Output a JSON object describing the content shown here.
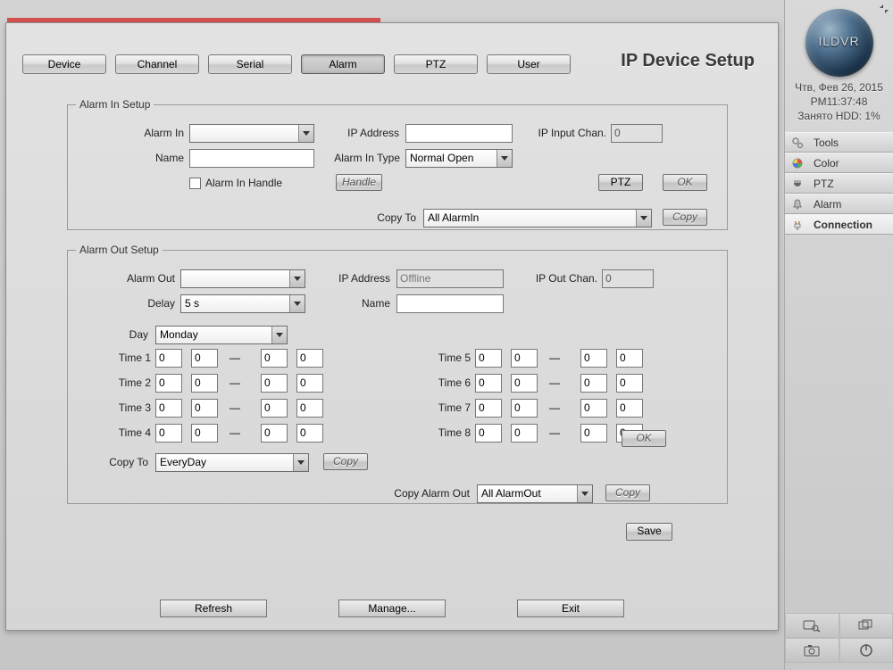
{
  "header": {
    "title": "IP Device Setup",
    "tabs": [
      "Device",
      "Channel",
      "Serial",
      "Alarm",
      "PTZ",
      "User"
    ],
    "active_tab_index": 3
  },
  "alarm_in": {
    "legend": "Alarm In Setup",
    "labels": {
      "alarm_in": "Alarm In",
      "ip_address": "IP Address",
      "ip_input_chan": "IP Input Chan.",
      "name": "Name",
      "alarm_in_type": "Alarm In Type",
      "handle_chk": "Alarm In Handle",
      "copy_to": "Copy To"
    },
    "values": {
      "alarm_in_sel": "",
      "ip_address": "",
      "ip_input_chan": "0",
      "name": "",
      "alarm_in_type": "Normal Open",
      "copy_to": "All AlarmIn"
    },
    "buttons": {
      "handle": "Handle",
      "ptz": "PTZ",
      "ok": "OK",
      "copy": "Copy"
    }
  },
  "alarm_out": {
    "legend": "Alarm Out Setup",
    "labels": {
      "alarm_out": "Alarm Out",
      "ip_address": "IP Address",
      "ip_out_chan": "IP Out Chan.",
      "delay": "Delay",
      "name": "Name",
      "day": "Day",
      "copy_to": "Copy To",
      "copy_alarm_out": "Copy Alarm Out"
    },
    "values": {
      "alarm_out_sel": "",
      "ip_address": "Offline",
      "ip_out_chan": "0",
      "delay": "5 s",
      "name": "",
      "day": "Monday",
      "copy_to_day": "EveryDay",
      "copy_alarm_out": "All AlarmOut"
    },
    "time_labels": [
      "Time 1",
      "Time 2",
      "Time 3",
      "Time 4",
      "Time 5",
      "Time 6",
      "Time 7",
      "Time 8"
    ],
    "time_values": [
      [
        "0",
        "0",
        "0",
        "0"
      ],
      [
        "0",
        "0",
        "0",
        "0"
      ],
      [
        "0",
        "0",
        "0",
        "0"
      ],
      [
        "0",
        "0",
        "0",
        "0"
      ],
      [
        "0",
        "0",
        "0",
        "0"
      ],
      [
        "0",
        "0",
        "0",
        "0"
      ],
      [
        "0",
        "0",
        "0",
        "0"
      ],
      [
        "0",
        "0",
        "0",
        "0"
      ]
    ],
    "buttons": {
      "copy_day": "Copy",
      "ok": "OK",
      "copy_out": "Copy"
    }
  },
  "footer": {
    "save": "Save",
    "refresh": "Refresh",
    "manage": "Manage...",
    "exit": "Exit"
  },
  "sidebar": {
    "logo_text": "ILDVR",
    "date": "Чтв, Фев 26, 2015",
    "time": "PM11:37:48",
    "hdd": "Занято HDD: 1%",
    "items": [
      {
        "label": "Tools"
      },
      {
        "label": "Color"
      },
      {
        "label": "PTZ"
      },
      {
        "label": "Alarm"
      },
      {
        "label": "Connection"
      }
    ],
    "active_item_index": 4
  }
}
